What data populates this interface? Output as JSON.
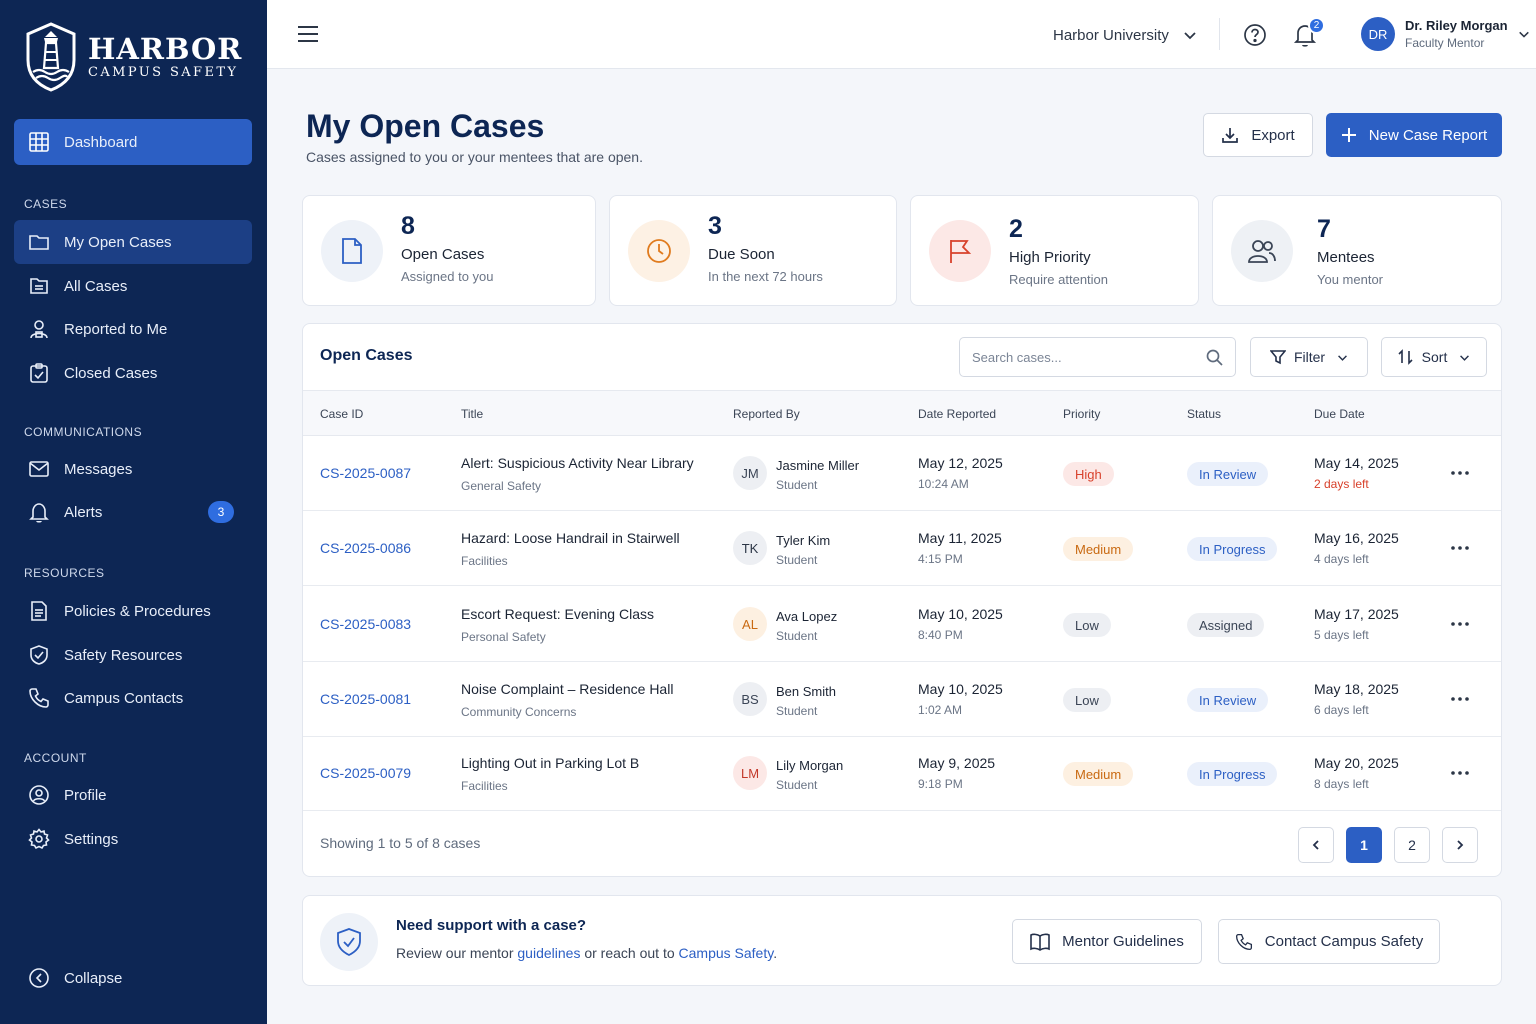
{
  "brand": {
    "name": "HARBOR",
    "sub": "CAMPUS SAFETY"
  },
  "sidebar": {
    "dashboard": "Dashboard",
    "sections": {
      "cases": "CASES",
      "communications": "COMMUNICATIONS",
      "resources": "RESOURCES",
      "account": "ACCOUNT"
    },
    "cases": [
      "My Open Cases",
      "All Cases",
      "Reported to Me",
      "Closed Cases"
    ],
    "communications": {
      "messages": "Messages",
      "alerts": "Alerts",
      "alerts_badge": "3"
    },
    "resources": [
      "Policies & Procedures",
      "Safety Resources",
      "Campus Contacts"
    ],
    "account": [
      "Profile",
      "Settings"
    ],
    "collapse": "Collapse"
  },
  "topbar": {
    "university": "Harbor University",
    "notifications": "2",
    "user": {
      "initials": "DR",
      "name": "Dr. Riley Morgan",
      "role": "Faculty Mentor"
    }
  },
  "header": {
    "title": "My Open Cases",
    "subtitle": "Cases assigned to you or your mentees that are open.",
    "export": "Export",
    "new_case": "New Case Report"
  },
  "stats": [
    {
      "value": "8",
      "label": "Open Cases",
      "sub": "Assigned to you",
      "icon": "document-icon"
    },
    {
      "value": "3",
      "label": "Due Soon",
      "sub": "In the next 72 hours",
      "icon": "clock-icon"
    },
    {
      "value": "2",
      "label": "High Priority",
      "sub": "Require attention",
      "icon": "flag-icon"
    },
    {
      "value": "7",
      "label": "Mentees",
      "sub": "You mentor",
      "icon": "users-icon"
    }
  ],
  "cases": {
    "title": "Open Cases",
    "search_placeholder": "Search cases...",
    "filter": "Filter",
    "sort": "Sort",
    "columns": [
      "Case ID",
      "Title",
      "Reported By",
      "Date Reported",
      "Priority",
      "Status",
      "Due Date"
    ],
    "rows": [
      {
        "id": "CS-2025-0087",
        "title": "Alert: Suspicious Activity Near Library",
        "category": "General Safety",
        "initials": "JM",
        "reporter": "Jasmine Miller",
        "role": "Student",
        "date": "May 12, 2025",
        "time": "10:24 AM",
        "priority": "High",
        "status": "In Review",
        "due": "May 14, 2025",
        "left": "2 days left",
        "urgent": true
      },
      {
        "id": "CS-2025-0086",
        "title": "Hazard: Loose Handrail in Stairwell",
        "category": "Facilities",
        "initials": "TK",
        "reporter": "Tyler Kim",
        "role": "Student",
        "date": "May 11, 2025",
        "time": "4:15 PM",
        "priority": "Medium",
        "status": "In Progress",
        "due": "May 16, 2025",
        "left": "4 days left",
        "urgent": false
      },
      {
        "id": "CS-2025-0083",
        "title": "Escort Request: Evening Class",
        "category": "Personal Safety",
        "initials": "AL",
        "reporter": "Ava Lopez",
        "role": "Student",
        "date": "May 10, 2025",
        "time": "8:40 PM",
        "priority": "Low",
        "status": "Assigned",
        "due": "May 17, 2025",
        "left": "5 days left",
        "urgent": false
      },
      {
        "id": "CS-2025-0081",
        "title": "Noise Complaint – Residence Hall",
        "category": "Community Concerns",
        "initials": "BS",
        "reporter": "Ben Smith",
        "role": "Student",
        "date": "May 10, 2025",
        "time": "1:02 AM",
        "priority": "Low",
        "status": "In Review",
        "due": "May 18, 2025",
        "left": "6 days left",
        "urgent": false
      },
      {
        "id": "CS-2025-0079",
        "title": "Lighting Out in Parking Lot B",
        "category": "Facilities",
        "initials": "LM",
        "reporter": "Lily Morgan",
        "role": "Student",
        "date": "May 9, 2025",
        "time": "9:18 PM",
        "priority": "Medium",
        "status": "In Progress",
        "due": "May 20, 2025",
        "left": "8 days left",
        "urgent": false
      }
    ],
    "showing": "Showing 1 to 5 of 8 cases",
    "pages": [
      "1",
      "2"
    ]
  },
  "support": {
    "title": "Need support with a case?",
    "text_before": "Review our mentor ",
    "link1": "guidelines",
    "text_mid": " or reach out to ",
    "link2": "Campus Safety",
    "text_after": ".",
    "guidelines_button": "Mentor Guidelines",
    "contact_button": "Contact Campus Safety"
  },
  "colors": {
    "sidebar": "#0d2654",
    "accent": "#2c5fc4",
    "high": "#d8412b",
    "medium": "#c96a12",
    "urgent": "#d8412b"
  }
}
